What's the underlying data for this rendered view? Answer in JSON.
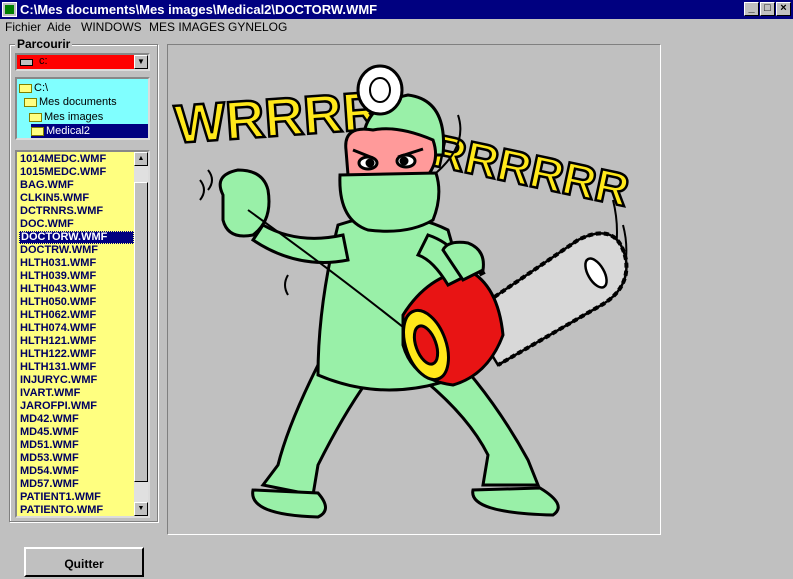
{
  "window": {
    "title": "C:\\Mes documents\\Mes images\\Medical2\\DOCTORW.WMF",
    "minimize_glyph": "_",
    "maximize_glyph": "□",
    "close_glyph": "×"
  },
  "menu": [
    "Fichier",
    "Aide",
    "WINDOWS",
    "MES IMAGES",
    "GYNELOG"
  ],
  "browser": {
    "group_label": "Parcourir",
    "drive": "c:",
    "dirs": [
      "C:\\",
      "Mes documents",
      "Mes images",
      "Medical2"
    ],
    "selected_dir": "Medical2",
    "files": [
      "1014MEDC.WMF",
      "1015MEDC.WMF",
      "BAG.WMF",
      "CLKIN5.WMF",
      "DCTRNRS.WMF",
      "DOC.WMF",
      "DOCTORW.WMF",
      "DOCTRW.WMF",
      "HLTH031.WMF",
      "HLTH039.WMF",
      "HLTH043.WMF",
      "HLTH050.WMF",
      "HLTH062.WMF",
      "HLTH074.WMF",
      "HLTH121.WMF",
      "HLTH122.WMF",
      "HLTH131.WMF",
      "INJURYC.WMF",
      "IVART.WMF",
      "JAROFPI.WMF",
      "MD42.WMF",
      "MD45.WMF",
      "MD51.WMF",
      "MD53.WMF",
      "MD54.WMF",
      "MD57.WMF",
      "PATIENT1.WMF",
      "PATIENTO.WMF"
    ],
    "selected_file": "DOCTORW.WMF"
  },
  "image": {
    "sound_text_left": "WRRRR",
    "sound_text_right": "RRRRRR",
    "colors": {
      "surgeon": "#99f0a8",
      "lettering": "#ffe81a",
      "chainsaw": "#e81414",
      "skin": "#ff9a9a",
      "blade": "#d8d8d8"
    }
  },
  "quit_label": "Quitter"
}
